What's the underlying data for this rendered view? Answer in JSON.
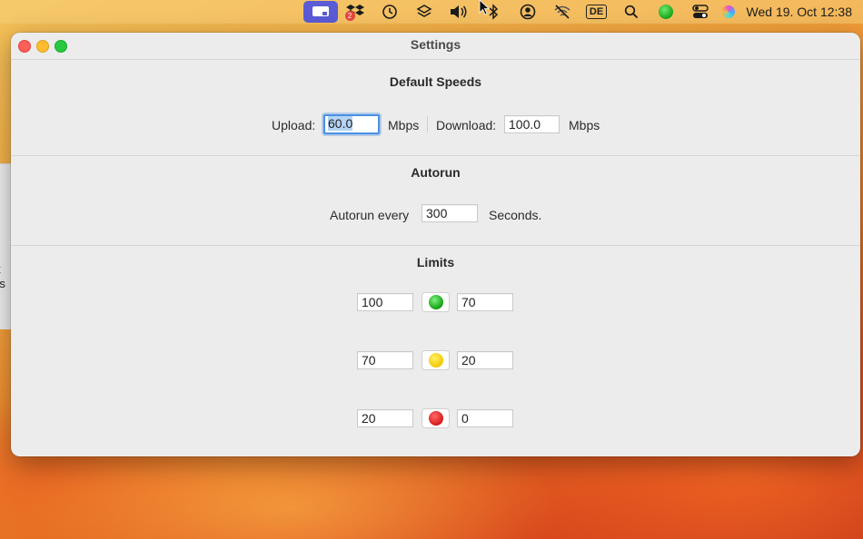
{
  "menubar": {
    "input_language": "DE",
    "clock": "Wed 19. Oct  12:38",
    "icons": [
      "app-active-icon",
      "dropbox-icon",
      "time-machine-icon",
      "layers-icon",
      "volume-icon",
      "bluetooth-icon",
      "user-icon",
      "wifi-off-icon",
      "input-source-icon",
      "spotlight-icon",
      "status-green-icon",
      "control-center-icon",
      "siri-icon"
    ],
    "dropbox_badge": "2"
  },
  "background_window": {
    "line1": "t",
    "line2": "rs"
  },
  "window": {
    "title": "Settings",
    "default_speeds": {
      "heading": "Default Speeds",
      "upload_label": "Upload:",
      "upload_value": "60.0",
      "upload_unit": "Mbps",
      "download_label": "Download:",
      "download_value": "100.0",
      "download_unit": "Mbps"
    },
    "autorun": {
      "heading": "Autorun",
      "prefix": "Autorun every",
      "value": "300",
      "suffix": "Seconds."
    },
    "limits": {
      "heading": "Limits",
      "rows": [
        {
          "low": "100",
          "high": "70",
          "color": "green"
        },
        {
          "low": "70",
          "high": "20",
          "color": "yellow"
        },
        {
          "low": "20",
          "high": "0",
          "color": "red"
        }
      ]
    }
  },
  "colors": {
    "green": "#19a519",
    "yellow": "#f4c800",
    "red": "#d81a1a",
    "accent": "#4a90e2"
  }
}
